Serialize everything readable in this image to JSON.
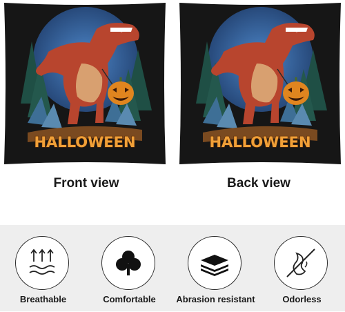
{
  "pillows": {
    "front": {
      "design_text": "HALLOWEEN",
      "label": "Front view"
    },
    "back": {
      "design_text": "HALLOWEEN",
      "label": "Back view"
    }
  },
  "features": [
    {
      "icon": "breathable-icon",
      "label": "Breathable"
    },
    {
      "icon": "comfortable-icon",
      "label": "Comfortable"
    },
    {
      "icon": "abrasion-resistant-icon",
      "label": "Abrasion resistant"
    },
    {
      "icon": "odorless-icon",
      "label": "Odorless"
    }
  ],
  "colors": {
    "pillow_background": "#161616",
    "moon": "#3a6aa8",
    "dinosaur": "#b8452e",
    "pumpkin": "#e0851f",
    "title": "#f0a038",
    "feature_band": "#eeeeee"
  }
}
